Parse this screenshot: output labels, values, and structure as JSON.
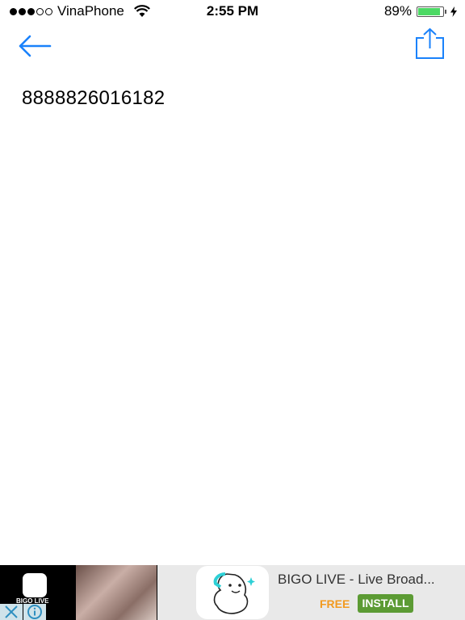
{
  "status_bar": {
    "signal_filled": 3,
    "signal_total": 5,
    "carrier": "VinaPhone",
    "time": "2:55 PM",
    "battery_percent_label": "89%",
    "battery_level": 0.89,
    "charging": true
  },
  "nav": {
    "back_icon": "arrow-left-icon",
    "share_icon": "share-icon",
    "accent_color": "#1a82fb"
  },
  "content": {
    "number": "8888826016182"
  },
  "ad": {
    "brand_label": "BIGO LIVE",
    "title": "BIGO LIVE - Live Broad...",
    "price": "FREE",
    "install_label": "INSTALL",
    "close_icon": "close-icon",
    "info_icon": "info-icon"
  }
}
